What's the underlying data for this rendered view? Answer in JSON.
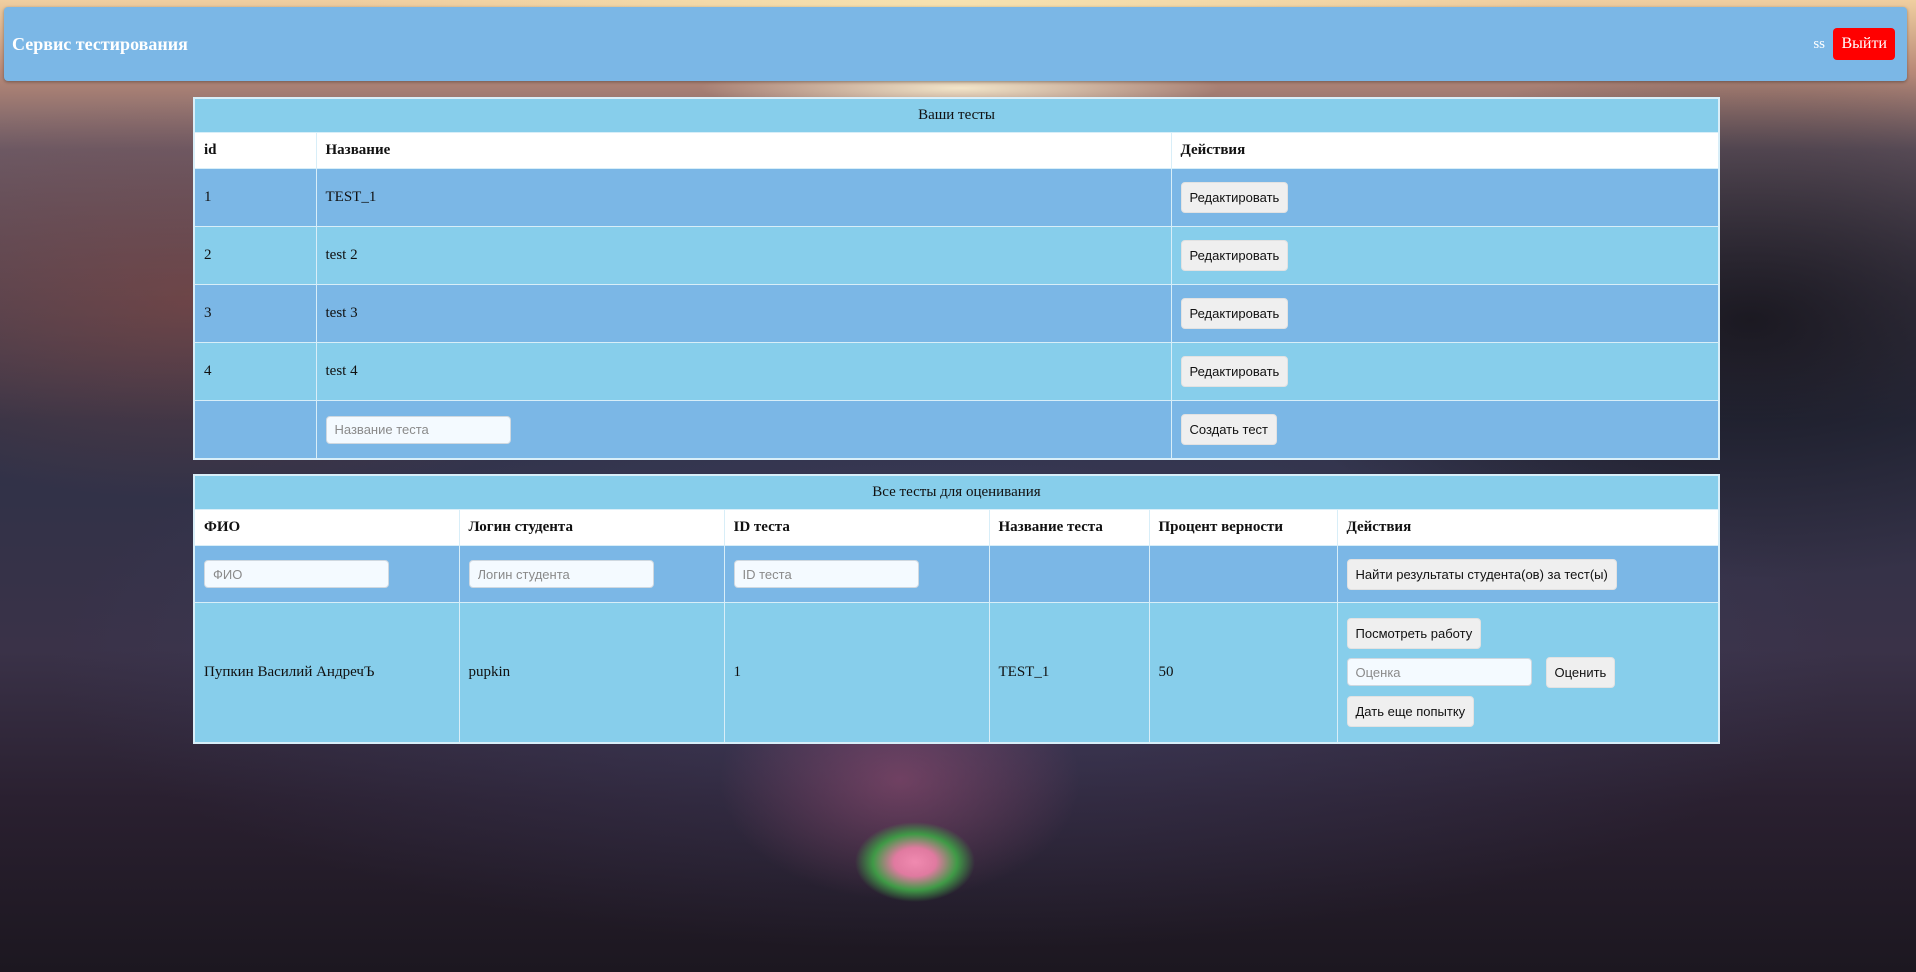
{
  "header": {
    "title": "Сервис тестирования",
    "user": "ss",
    "logout_label": "Выйти"
  },
  "your_tests": {
    "caption": "Ваши тесты",
    "columns": [
      "id",
      "Название",
      "Действия"
    ],
    "rows": [
      {
        "id": "1",
        "name": "TEST_1",
        "action": "Редактировать"
      },
      {
        "id": "2",
        "name": "test 2",
        "action": "Редактировать"
      },
      {
        "id": "3",
        "name": "test 3",
        "action": "Редактировать"
      },
      {
        "id": "4",
        "name": "test 4",
        "action": "Редактировать"
      }
    ],
    "new_test_placeholder": "Название теста",
    "create_label": "Создать тест"
  },
  "grading": {
    "caption": "Все тесты для оценивания",
    "columns": [
      "ФИО",
      "Логин студента",
      "ID теста",
      "Название теста",
      "Процент верности",
      "Действия"
    ],
    "filters": {
      "fio_placeholder": "ФИО",
      "login_placeholder": "Логин студента",
      "test_id_placeholder": "ID теста",
      "search_label": "Найти результаты студента(ов) за тест(ы)"
    },
    "rows": [
      {
        "fio": "Пупкин Василий АндречЪ",
        "login": "pupkin",
        "test_id": "1",
        "test_name": "TEST_1",
        "percent": "50",
        "view_label": "Посмотреть работу",
        "grade_placeholder": "Оценка",
        "grade_label": "Оценить",
        "retry_label": "Дать еще попытку"
      }
    ]
  }
}
